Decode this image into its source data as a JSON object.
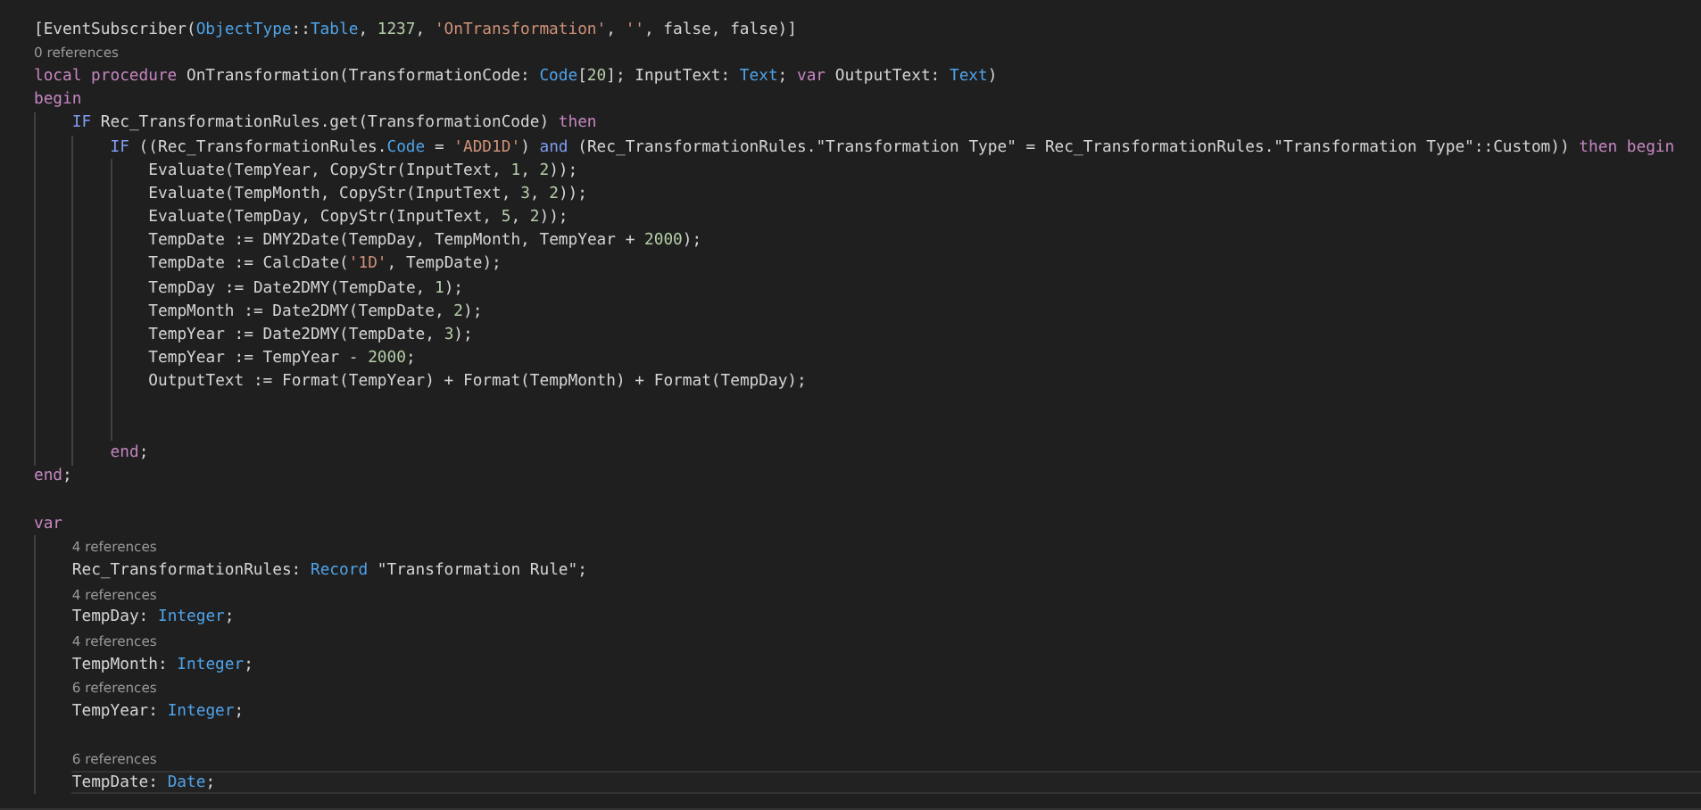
{
  "editor": {
    "lines": [
      {
        "kind": "code",
        "current": false,
        "tokens": [
          {
            "kind": "plain",
            "text": "[EventSubscriber("
          },
          {
            "kind": "type",
            "text": "ObjectType"
          },
          {
            "kind": "plain",
            "text": "::"
          },
          {
            "kind": "type",
            "text": "Table"
          },
          {
            "kind": "plain",
            "text": ", "
          },
          {
            "kind": "number",
            "text": "1237"
          },
          {
            "kind": "plain",
            "text": ", "
          },
          {
            "kind": "string",
            "text": "'OnTransformation'"
          },
          {
            "kind": "plain",
            "text": ", "
          },
          {
            "kind": "string",
            "text": "''"
          },
          {
            "kind": "plain",
            "text": ", false, false)]"
          }
        ]
      },
      {
        "kind": "lens",
        "current": false,
        "text": "0 references"
      },
      {
        "kind": "code",
        "current": false,
        "tokens": [
          {
            "kind": "control",
            "text": "local procedure"
          },
          {
            "kind": "plain",
            "text": " OnTransformation(TransformationCode: "
          },
          {
            "kind": "type",
            "text": "Code"
          },
          {
            "kind": "plain",
            "text": "["
          },
          {
            "kind": "number",
            "text": "20"
          },
          {
            "kind": "plain",
            "text": "]; InputText: "
          },
          {
            "kind": "type",
            "text": "Text"
          },
          {
            "kind": "plain",
            "text": "; "
          },
          {
            "kind": "control",
            "text": "var"
          },
          {
            "kind": "plain",
            "text": " OutputText: "
          },
          {
            "kind": "type",
            "text": "Text"
          },
          {
            "kind": "plain",
            "text": ")"
          }
        ]
      },
      {
        "kind": "code",
        "current": false,
        "tokens": [
          {
            "kind": "control",
            "text": "begin"
          }
        ],
        "children": [
          {
            "kind": "code",
            "current": false,
            "tokens": [
              {
                "kind": "keyword",
                "text": "IF"
              },
              {
                "kind": "plain",
                "text": " Rec_TransformationRules.get(TransformationCode) "
              },
              {
                "kind": "control",
                "text": "then"
              }
            ],
            "children": [
              {
                "kind": "code",
                "current": false,
                "tokens": [
                  {
                    "kind": "keyword",
                    "text": "IF"
                  },
                  {
                    "kind": "plain",
                    "text": " ((Rec_TransformationRules."
                  },
                  {
                    "kind": "type",
                    "text": "Code"
                  },
                  {
                    "kind": "plain",
                    "text": " = "
                  },
                  {
                    "kind": "string",
                    "text": "'ADD1D'"
                  },
                  {
                    "kind": "plain",
                    "text": ") "
                  },
                  {
                    "kind": "keyword",
                    "text": "and"
                  },
                  {
                    "kind": "plain",
                    "text": " (Rec_TransformationRules.\"Transformation Type\" = Rec_TransformationRules.\"Transformation Type\"::Custom)) "
                  },
                  {
                    "kind": "control",
                    "text": "then begin"
                  }
                ],
                "children": [
                  {
                    "kind": "code",
                    "current": false,
                    "tokens": [
                      {
                        "kind": "plain",
                        "text": "Evaluate(TempYear, CopyStr(InputText, "
                      },
                      {
                        "kind": "number",
                        "text": "1"
                      },
                      {
                        "kind": "plain",
                        "text": ", "
                      },
                      {
                        "kind": "number",
                        "text": "2"
                      },
                      {
                        "kind": "plain",
                        "text": "));"
                      }
                    ]
                  },
                  {
                    "kind": "code",
                    "current": false,
                    "tokens": [
                      {
                        "kind": "plain",
                        "text": "Evaluate(TempMonth, CopyStr(InputText, "
                      },
                      {
                        "kind": "number",
                        "text": "3"
                      },
                      {
                        "kind": "plain",
                        "text": ", "
                      },
                      {
                        "kind": "number",
                        "text": "2"
                      },
                      {
                        "kind": "plain",
                        "text": "));"
                      }
                    ]
                  },
                  {
                    "kind": "code",
                    "current": false,
                    "tokens": [
                      {
                        "kind": "plain",
                        "text": "Evaluate(TempDay, CopyStr(InputText, "
                      },
                      {
                        "kind": "number",
                        "text": "5"
                      },
                      {
                        "kind": "plain",
                        "text": ", "
                      },
                      {
                        "kind": "number",
                        "text": "2"
                      },
                      {
                        "kind": "plain",
                        "text": "));"
                      }
                    ]
                  },
                  {
                    "kind": "code",
                    "current": false,
                    "tokens": [
                      {
                        "kind": "plain",
                        "text": "TempDate := DMY2Date(TempDay, TempMonth, TempYear + "
                      },
                      {
                        "kind": "number",
                        "text": "2000"
                      },
                      {
                        "kind": "plain",
                        "text": ");"
                      }
                    ]
                  },
                  {
                    "kind": "code",
                    "current": false,
                    "tokens": [
                      {
                        "kind": "plain",
                        "text": "TempDate := CalcDate("
                      },
                      {
                        "kind": "string",
                        "text": "'1D'"
                      },
                      {
                        "kind": "plain",
                        "text": ", TempDate);"
                      }
                    ]
                  },
                  {
                    "kind": "code",
                    "current": false,
                    "tokens": [
                      {
                        "kind": "plain",
                        "text": "TempDay := Date2DMY(TempDate, "
                      },
                      {
                        "kind": "number",
                        "text": "1"
                      },
                      {
                        "kind": "plain",
                        "text": ");"
                      }
                    ]
                  },
                  {
                    "kind": "code",
                    "current": false,
                    "tokens": [
                      {
                        "kind": "plain",
                        "text": "TempMonth := Date2DMY(TempDate, "
                      },
                      {
                        "kind": "number",
                        "text": "2"
                      },
                      {
                        "kind": "plain",
                        "text": ");"
                      }
                    ]
                  },
                  {
                    "kind": "code",
                    "current": false,
                    "tokens": [
                      {
                        "kind": "plain",
                        "text": "TempYear := Date2DMY(TempDate, "
                      },
                      {
                        "kind": "number",
                        "text": "3"
                      },
                      {
                        "kind": "plain",
                        "text": ");"
                      }
                    ]
                  },
                  {
                    "kind": "code",
                    "current": false,
                    "tokens": [
                      {
                        "kind": "plain",
                        "text": "TempYear := TempYear - "
                      },
                      {
                        "kind": "number",
                        "text": "2000"
                      },
                      {
                        "kind": "plain",
                        "text": ";"
                      }
                    ]
                  },
                  {
                    "kind": "code",
                    "current": false,
                    "tokens": [
                      {
                        "kind": "plain",
                        "text": "OutputText := Format(TempYear) + Format(TempMonth) + Format(TempDay);"
                      }
                    ]
                  },
                  {
                    "kind": "blank"
                  },
                  {
                    "kind": "blank"
                  }
                ]
              },
              {
                "kind": "code",
                "current": false,
                "tokens": [
                  {
                    "kind": "control",
                    "text": "end"
                  },
                  {
                    "kind": "plain",
                    "text": ";"
                  }
                ]
              }
            ]
          }
        ]
      },
      {
        "kind": "code",
        "current": false,
        "tokens": [
          {
            "kind": "control",
            "text": "end"
          },
          {
            "kind": "plain",
            "text": ";"
          }
        ]
      },
      {
        "kind": "blank"
      },
      {
        "kind": "code",
        "current": false,
        "tokens": [
          {
            "kind": "control",
            "text": "var"
          }
        ],
        "children": [
          {
            "kind": "lens",
            "current": false,
            "text": "4 references"
          },
          {
            "kind": "code",
            "current": false,
            "tokens": [
              {
                "kind": "plain",
                "text": "Rec_TransformationRules: "
              },
              {
                "kind": "type",
                "text": "Record"
              },
              {
                "kind": "plain",
                "text": " \"Transformation Rule\";"
              }
            ]
          },
          {
            "kind": "lens",
            "current": false,
            "text": "4 references"
          },
          {
            "kind": "code",
            "current": false,
            "tokens": [
              {
                "kind": "plain",
                "text": "TempDay: "
              },
              {
                "kind": "type",
                "text": "Integer"
              },
              {
                "kind": "plain",
                "text": ";"
              }
            ]
          },
          {
            "kind": "lens",
            "current": false,
            "text": "4 references"
          },
          {
            "kind": "code",
            "current": false,
            "tokens": [
              {
                "kind": "plain",
                "text": "TempMonth: "
              },
              {
                "kind": "type",
                "text": "Integer"
              },
              {
                "kind": "plain",
                "text": ";"
              }
            ]
          },
          {
            "kind": "lens",
            "current": false,
            "text": "6 references"
          },
          {
            "kind": "code",
            "current": false,
            "tokens": [
              {
                "kind": "plain",
                "text": "TempYear: "
              },
              {
                "kind": "type",
                "text": "Integer"
              },
              {
                "kind": "plain",
                "text": ";"
              }
            ]
          },
          {
            "kind": "blank"
          },
          {
            "kind": "lens",
            "current": false,
            "text": "6 references"
          },
          {
            "kind": "code",
            "current": true,
            "tokens": [
              {
                "kind": "plain",
                "text": "TempDate: "
              },
              {
                "kind": "type",
                "text": "Date"
              },
              {
                "kind": "plain",
                "text": ";"
              }
            ]
          }
        ]
      }
    ]
  }
}
